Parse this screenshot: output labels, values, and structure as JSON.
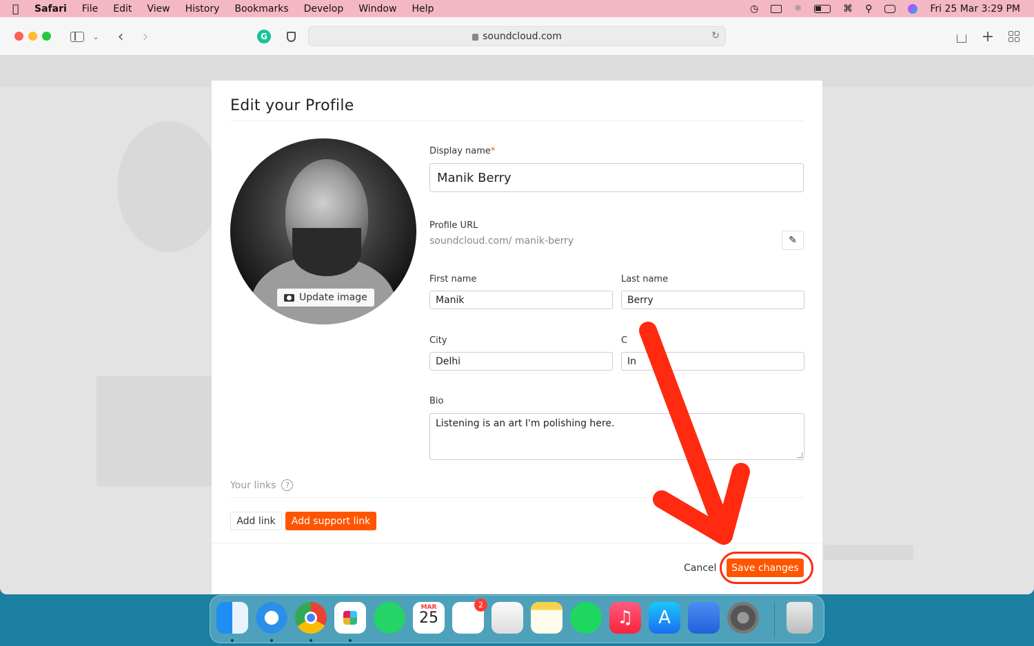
{
  "menubar": {
    "app_name": "Safari",
    "menus": [
      "File",
      "Edit",
      "View",
      "History",
      "Bookmarks",
      "Develop",
      "Window",
      "Help"
    ],
    "datetime": "Fri 25 Mar  3:29 PM"
  },
  "browser": {
    "url": "soundcloud.com"
  },
  "modal": {
    "title": "Edit your Profile",
    "avatar_button": "Update image",
    "display_name_label": "Display name",
    "required_mark": "*",
    "display_name_value": "Manik Berry",
    "profile_url_label": "Profile URL",
    "profile_url_prefix": "soundcloud.com/",
    "profile_url_slug": "manik-berry",
    "first_name_label": "First name",
    "first_name_value": "Manik",
    "last_name_label": "Last name",
    "last_name_value": "Berry",
    "city_label": "City",
    "city_value": "Delhi",
    "country_label_visible_start": "C",
    "country_label_visible_end": "y",
    "country_value_visible": "In",
    "bio_label": "Bio",
    "bio_value": "Listening is an art I'm polishing here.",
    "links_label": "Your links",
    "help_glyph": "?",
    "add_link": "Add link",
    "add_support_link": "Add support link",
    "cancel": "Cancel",
    "save": "Save changes"
  },
  "dock": {
    "calendar_month": "MAR",
    "calendar_day": "25",
    "reminders_badge": "2"
  },
  "colors": {
    "accent": "#ff5500",
    "annotation": "#ff2a10"
  }
}
